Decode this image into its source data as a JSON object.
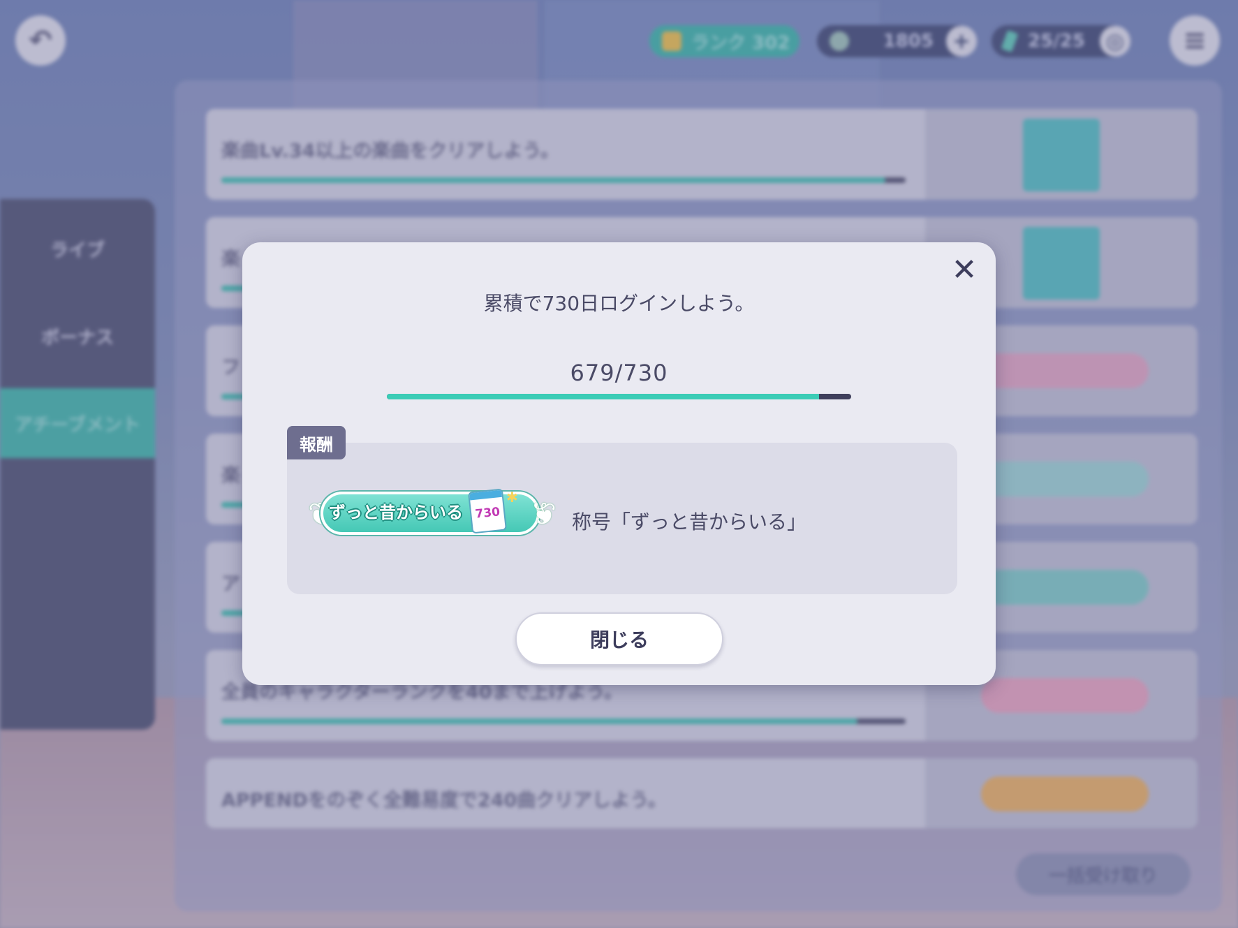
{
  "header": {
    "back_icon": "back-arrow-icon",
    "rank_label": "ランク 302",
    "currency_amount": "1805",
    "stamina": "25/25",
    "menu_icon": "hamburger-menu-icon"
  },
  "sidebar": {
    "items": [
      {
        "label": "ライブ"
      },
      {
        "label": "ボーナス"
      },
      {
        "label": "アチーブメント"
      }
    ]
  },
  "missions": [
    {
      "text": "楽曲Lv.34以上の楽曲をクリアしよう。",
      "progress": 0.97
    },
    {
      "text": "楽",
      "progress": 0.97
    },
    {
      "text": "フ",
      "progress": 0.97
    },
    {
      "text": "楽",
      "progress": 0.97
    },
    {
      "text": "ア",
      "progress": 0.97
    },
    {
      "text": "全員のキャラクターランクを40まで上げよう。",
      "progress": 0.93
    },
    {
      "text": "APPENDをのぞく全難易度で240曲クリアしよう。",
      "progress": null
    }
  ],
  "bulk_receive_label": "一括受け取り",
  "modal": {
    "mission_text": "累積で730日ログインしよう。",
    "progress_text": "679/730",
    "progress_current": 679,
    "progress_total": 730,
    "reward_tag": "報酬",
    "badge_text": "ずっと昔からいる",
    "badge_number": "730",
    "reward_name": "称号「ずっと昔からいる」",
    "close_label": "閉じる",
    "close_icon": "close-x-icon"
  },
  "colors": {
    "accent": "#3bccb6",
    "modal_bg": "#eaeaf2",
    "text": "#4a4a66"
  }
}
